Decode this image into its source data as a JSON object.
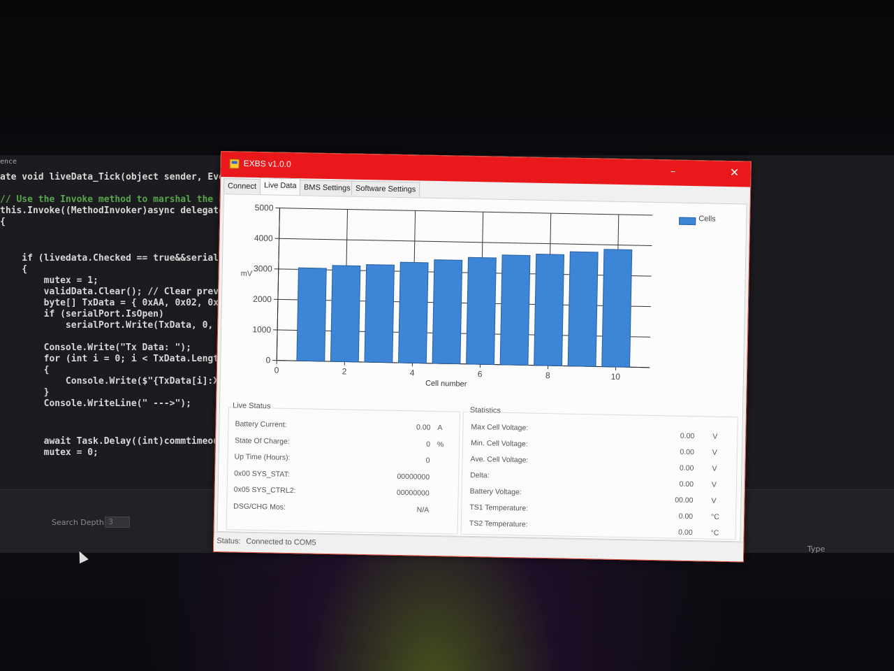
{
  "ide": {
    "header_fragment": "ence",
    "lines": [
      "ate void liveData_Tick(object sender, Even",
      "// Use the Invoke method to marshal the ca",
      "this.Invoke((MethodInvoker)async delegate",
      "{",
      "    if (livedata.Checked == true&&serialPo",
      "    {",
      "        mutex = 1;",
      "        validData.Clear(); // Clear previo",
      "        byte[] TxData = { 0xAA, 0x02, 0xBB",
      "        if (serialPort.IsOpen)",
      "            serialPort.Write(TxData, 0, Tx",
      "        Console.Write(\"Tx Data: \");",
      "        for (int i = 0; i < TxData.Length;",
      "        {",
      "            Console.Write($\"{TxData[i]:X2}",
      "        }",
      "        Console.WriteLine(\" --->\");",
      "        await Task.Delay((int)commtimeout.",
      "        mutex = 0;"
    ],
    "search_depth_label": "Search Depth:",
    "search_depth_value": "3",
    "type_label": "Type"
  },
  "window": {
    "title": "EXBS v1.0.0",
    "minimize": "–",
    "close": "✕",
    "tabs": [
      {
        "label": "Connect",
        "active": false
      },
      {
        "label": "Live Data",
        "active": true
      },
      {
        "label": "BMS Settings",
        "active": false
      },
      {
        "label": "Software Settings",
        "active": false
      }
    ]
  },
  "chart_data": {
    "type": "bar",
    "x": [
      1,
      2,
      3,
      4,
      5,
      6,
      7,
      8,
      9,
      10
    ],
    "series": [
      {
        "name": "Cells",
        "values": [
          3050,
          3150,
          3200,
          3300,
          3400,
          3500,
          3600,
          3650,
          3750,
          3850
        ]
      }
    ],
    "xlabel": "Cell number",
    "ylabel": "mV",
    "ylim": [
      0,
      5000
    ],
    "xlim": [
      0,
      11
    ],
    "yticks": [
      "0",
      "1000",
      "2000",
      "3000",
      "4000",
      "5000"
    ],
    "xticks": [
      "0",
      "2",
      "4",
      "6",
      "8",
      "10"
    ],
    "grid": true,
    "legend": "top-right",
    "bar_color": "#3d85d6"
  },
  "live_status": {
    "title": "Live Status",
    "rows": [
      {
        "label": "Battery Current:",
        "value": "0.00",
        "unit": "A"
      },
      {
        "label": "State Of Charge:",
        "value": "0",
        "unit": "%"
      },
      {
        "label": "Up Time (Hours):",
        "value": "0",
        "unit": ""
      },
      {
        "label": "0x00 SYS_STAT:",
        "value": "00000000",
        "unit": ""
      },
      {
        "label": "0x05 SYS_CTRL2:",
        "value": "00000000",
        "unit": ""
      },
      {
        "label": "DSG/CHG Mos:",
        "value": "N/A",
        "unit": ""
      }
    ]
  },
  "statistics": {
    "title": "Statistics",
    "rows": [
      {
        "label": "Max Cell Voltage:",
        "value": "0.00",
        "unit": "V"
      },
      {
        "label": "Min. Cell Voltage:",
        "value": "0.00",
        "unit": "V"
      },
      {
        "label": "Ave. Cell Voltage:",
        "value": "0.00",
        "unit": "V"
      },
      {
        "label": "Delta:",
        "value": "0.00",
        "unit": "V"
      },
      {
        "label": "Battery Voltage:",
        "value": "00.00",
        "unit": "V"
      },
      {
        "label": "TS1 Temperature:",
        "value": "0.00",
        "unit": "°C"
      },
      {
        "label": "TS2 Temperature:",
        "value": "0.00",
        "unit": "°C"
      }
    ]
  },
  "status_bar": {
    "label": "Status:",
    "value": "Connected to COM5"
  }
}
